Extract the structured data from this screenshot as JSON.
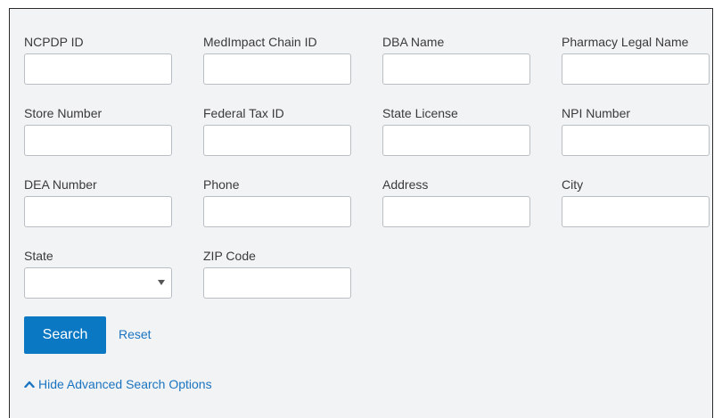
{
  "form": {
    "fields": [
      {
        "key": "ncpdp_id",
        "label": "NCPDP ID",
        "type": "text",
        "value": ""
      },
      {
        "key": "medimpact_chain_id",
        "label": "MedImpact Chain ID",
        "type": "text",
        "value": ""
      },
      {
        "key": "dba_name",
        "label": "DBA Name",
        "type": "text",
        "value": ""
      },
      {
        "key": "pharmacy_legal_name",
        "label": "Pharmacy Legal Name",
        "type": "text",
        "value": ""
      },
      {
        "key": "store_number",
        "label": "Store Number",
        "type": "text",
        "value": ""
      },
      {
        "key": "federal_tax_id",
        "label": "Federal Tax ID",
        "type": "text",
        "value": ""
      },
      {
        "key": "state_license",
        "label": "State License",
        "type": "text",
        "value": ""
      },
      {
        "key": "npi_number",
        "label": "NPI Number",
        "type": "text",
        "value": ""
      },
      {
        "key": "dea_number",
        "label": "DEA Number",
        "type": "text",
        "value": ""
      },
      {
        "key": "phone",
        "label": "Phone",
        "type": "text",
        "value": ""
      },
      {
        "key": "address",
        "label": "Address",
        "type": "text",
        "value": ""
      },
      {
        "key": "city",
        "label": "City",
        "type": "text",
        "value": ""
      },
      {
        "key": "state",
        "label": "State",
        "type": "select",
        "value": ""
      },
      {
        "key": "zip_code",
        "label": "ZIP Code",
        "type": "text",
        "value": ""
      }
    ]
  },
  "actions": {
    "search_label": "Search",
    "reset_label": "Reset"
  },
  "advanced": {
    "toggle_label": "Hide Advanced Search Options",
    "icon": "chevron-up-icon"
  },
  "colors": {
    "panel_bg": "#f2f3f5",
    "primary": "#0b78c4",
    "link": "#1a74c0",
    "label_text": "#3a3a3a",
    "input_border": "#b9bec4"
  }
}
